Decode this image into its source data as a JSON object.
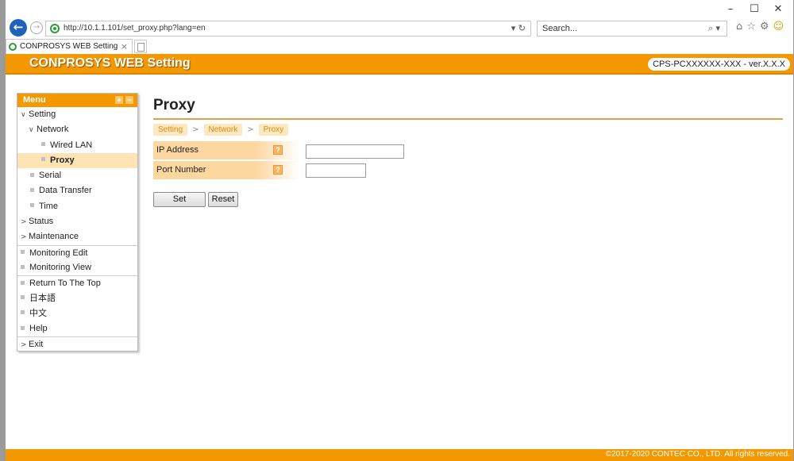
{
  "browser": {
    "url": "http://10.1.1.101/set_proxy.php?lang=en",
    "search_placeholder": "Search...",
    "tab_title": "CONPROSYS WEB Setting"
  },
  "header": {
    "app_title": "CONPROSYS WEB Setting",
    "version": "CPS-PCXXXXXX-XXX - ver.X.X.X"
  },
  "menu": {
    "title": "Menu",
    "items": [
      {
        "label": "Setting"
      },
      {
        "label": "Network"
      },
      {
        "label": "Wired LAN"
      },
      {
        "label": "Proxy"
      },
      {
        "label": "Serial"
      },
      {
        "label": "Data Transfer"
      },
      {
        "label": "Time"
      },
      {
        "label": "Status"
      },
      {
        "label": "Maintenance"
      },
      {
        "label": "Monitoring Edit"
      },
      {
        "label": "Monitoring View"
      },
      {
        "label": "Return To The Top"
      },
      {
        "label": "日本語"
      },
      {
        "label": "中文"
      },
      {
        "label": "Help"
      },
      {
        "label": "Exit"
      }
    ]
  },
  "main": {
    "title": "Proxy",
    "breadcrumb": [
      "Setting",
      "Network",
      "Proxy"
    ],
    "fields": [
      {
        "label": "IP Address",
        "value": ""
      },
      {
        "label": "Port Number",
        "value": ""
      }
    ],
    "buttons": {
      "set": "Set",
      "reset": "Reset"
    }
  },
  "footer": {
    "copyright": "©2017-2020 CONTEC CO., LTD. All rights reserved."
  },
  "colors": {
    "accent": "#f39800",
    "row_bg": "#fdd7a0",
    "crumb_bg": "#fde8c4",
    "browser_back": "#1d63b8"
  },
  "icons": [
    "back-arrow-icon",
    "forward-arrow-icon",
    "site-favicon-icon",
    "refresh-icon",
    "search-icon",
    "home-icon",
    "favorites-star-icon",
    "settings-gear-icon",
    "smiley-feedback-icon",
    "help-question-icon"
  ]
}
